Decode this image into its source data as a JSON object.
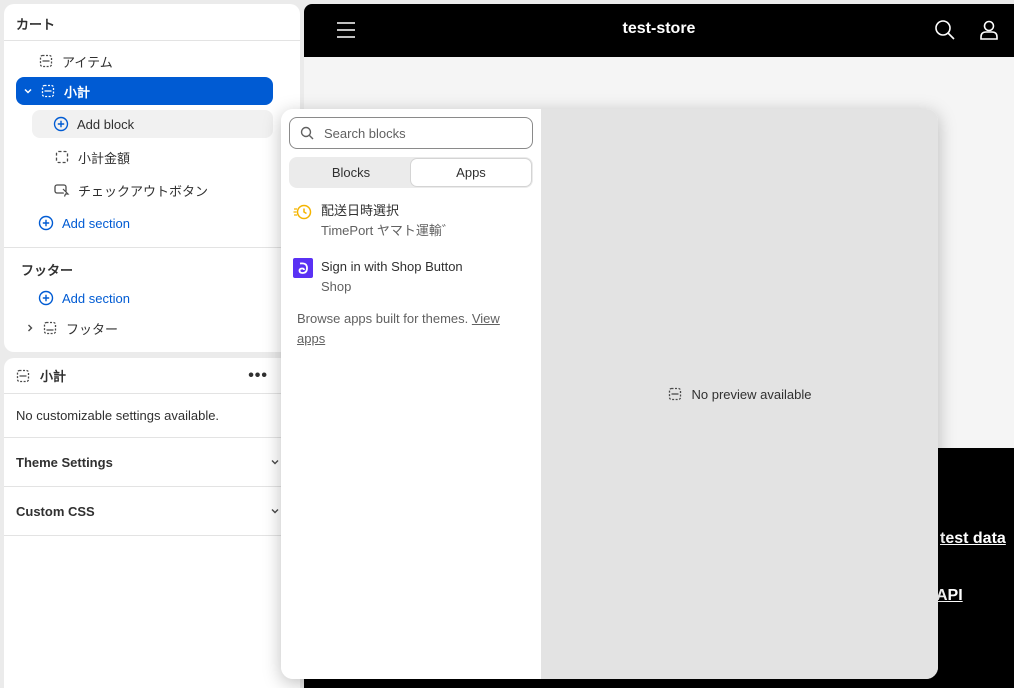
{
  "sidebar": {
    "cart_section_title": "カート",
    "items_label": "アイテム",
    "subtotal_label": "小計",
    "add_block_label": "Add block",
    "subtotal_amount_label": "小計金額",
    "checkout_button_label": "チェックアウトボタン",
    "add_section_label": "Add section",
    "footer_section_title": "フッター",
    "footer_add_section_label": "Add section",
    "footer_label": "フッター"
  },
  "settings_panel": {
    "title": "小計",
    "menu_label": "•••",
    "empty_message": "No customizable settings available.",
    "theme_settings_label": "Theme Settings",
    "custom_css_label": "Custom CSS"
  },
  "preview": {
    "store_name": "test-store",
    "footer_link_1": "test data",
    "footer_link_2": "API"
  },
  "block_picker": {
    "search_placeholder": "Search blocks",
    "tabs": [
      {
        "label": "Blocks",
        "active": false
      },
      {
        "label": "Apps",
        "active": true
      }
    ],
    "apps": [
      {
        "name": "配送日時選択",
        "vendor": "TimePort ヤマト運輸゛",
        "icon": "clock-truck-icon"
      },
      {
        "name": "Sign in with Shop Button",
        "vendor": "Shop",
        "icon": "shop-icon"
      }
    ],
    "browse_text": "Browse apps built for themes. ",
    "browse_link": "View apps",
    "preview_message": "No preview available"
  },
  "colors": {
    "accent": "#005bd3",
    "shop_purple": "#5a31f4",
    "timeport_yellow": "#f4b400"
  }
}
